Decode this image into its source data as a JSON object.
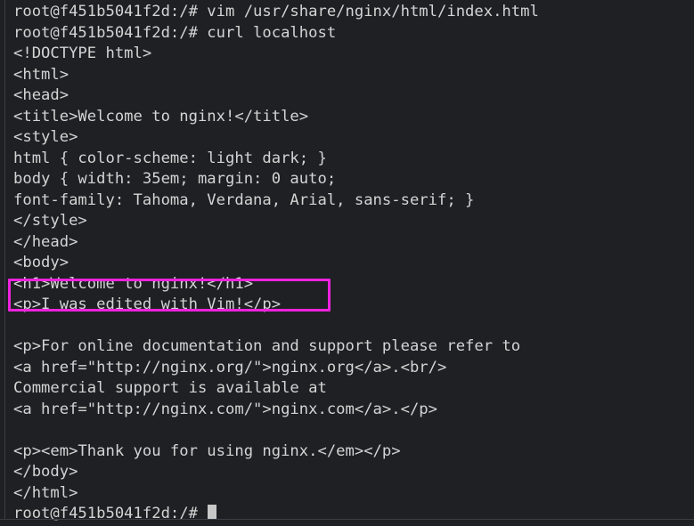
{
  "terminal": {
    "prompt": "root@f451b5041f2d:/#",
    "background_color": "#1e2023",
    "text_color": "#d4d4d4",
    "highlight_color": "#ee22dd",
    "cursor_color": "#c8c8c8",
    "lines": [
      {
        "text": "root@f451b5041f2d:/# vim /usr/share/nginx/html/index.html",
        "kind": "command"
      },
      {
        "text": "root@f451b5041f2d:/# curl localhost",
        "kind": "command"
      },
      {
        "text": "<!DOCTYPE html>",
        "kind": "output"
      },
      {
        "text": "<html>",
        "kind": "output"
      },
      {
        "text": "<head>",
        "kind": "output"
      },
      {
        "text": "<title>Welcome to nginx!</title>",
        "kind": "output"
      },
      {
        "text": "<style>",
        "kind": "output"
      },
      {
        "text": "html { color-scheme: light dark; }",
        "kind": "output"
      },
      {
        "text": "body { width: 35em; margin: 0 auto;",
        "kind": "output"
      },
      {
        "text": "font-family: Tahoma, Verdana, Arial, sans-serif; }",
        "kind": "output"
      },
      {
        "text": "</style>",
        "kind": "output"
      },
      {
        "text": "</head>",
        "kind": "output"
      },
      {
        "text": "<body>",
        "kind": "output"
      },
      {
        "text": "<h1>Welcome to nginx!</h1>",
        "kind": "output"
      },
      {
        "text": "<p>I was edited with Vim!</p>",
        "kind": "output-highlighted"
      },
      {
        "text": "",
        "kind": "blank"
      },
      {
        "text": "<p>For online documentation and support please refer to",
        "kind": "output"
      },
      {
        "text": "<a href=\"http://nginx.org/\">nginx.org</a>.<br/>",
        "kind": "output"
      },
      {
        "text": "Commercial support is available at",
        "kind": "output"
      },
      {
        "text": "<a href=\"http://nginx.com/\">nginx.com</a>.</p>",
        "kind": "output"
      },
      {
        "text": "",
        "kind": "blank"
      },
      {
        "text": "<p><em>Thank you for using nginx.</em></p>",
        "kind": "output"
      },
      {
        "text": "</body>",
        "kind": "output"
      },
      {
        "text": "</html>",
        "kind": "output"
      },
      {
        "text": "root@f451b5041f2d:/# ",
        "kind": "prompt-active"
      }
    ]
  }
}
